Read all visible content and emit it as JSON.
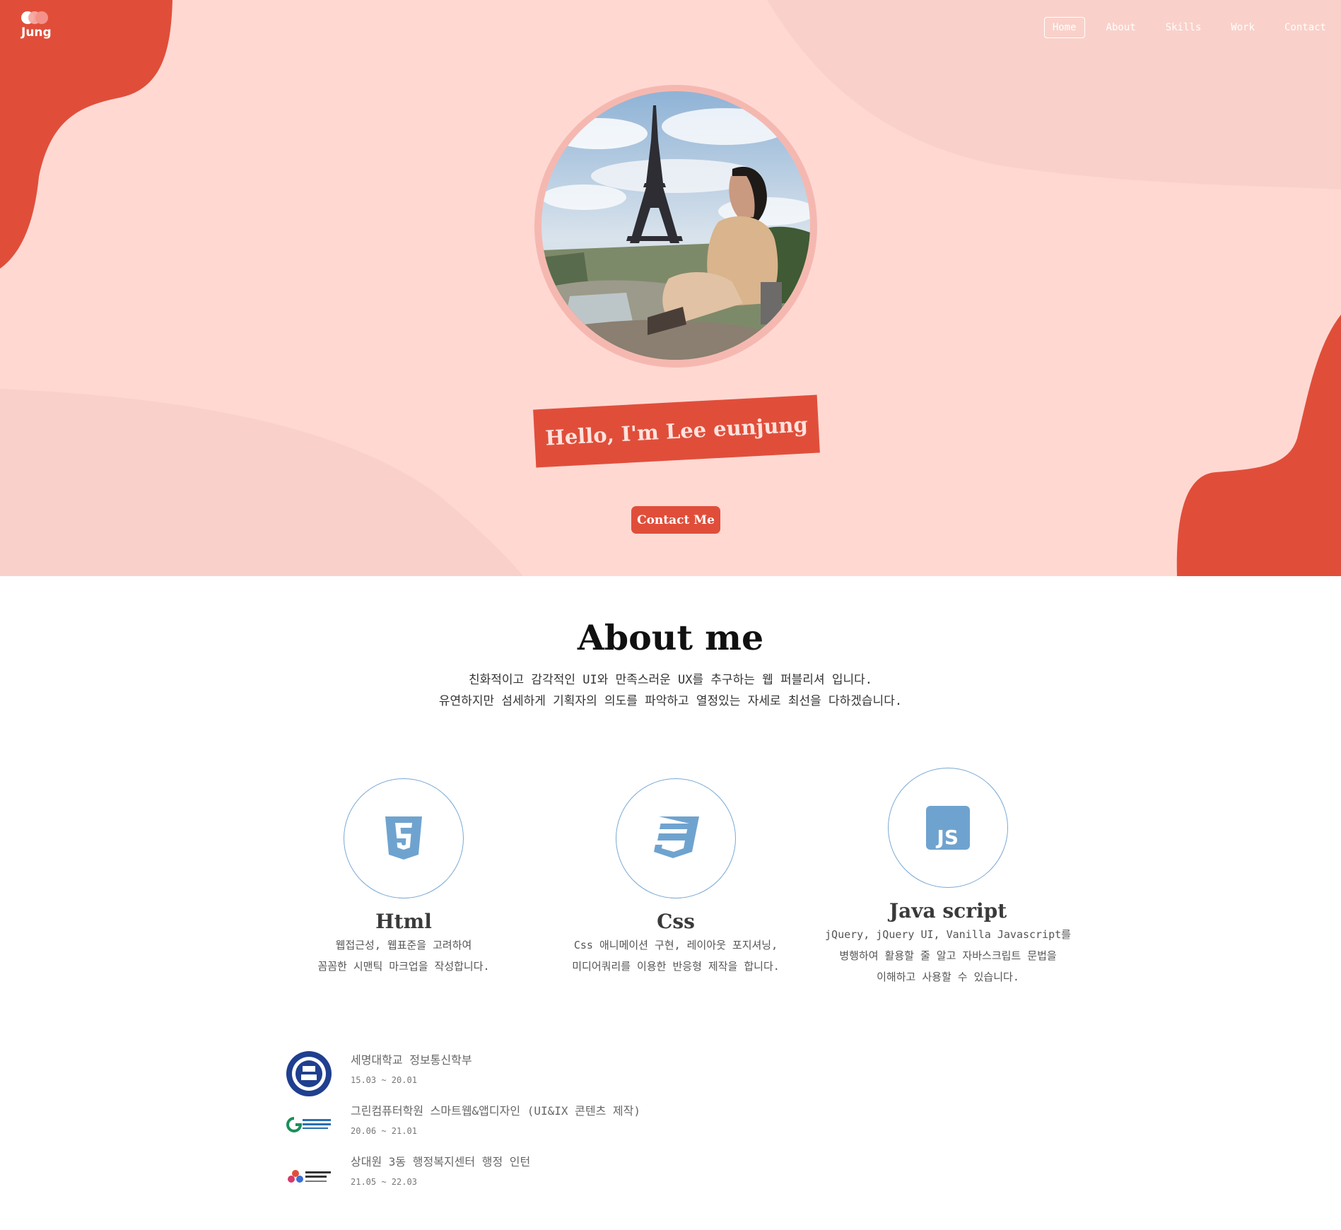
{
  "brand": {
    "logo_text": "Jung"
  },
  "nav": {
    "items": [
      "Home",
      "About",
      "Skills",
      "Work",
      "Contact"
    ],
    "active": "Home"
  },
  "hero": {
    "greeting": "Hello, I'm Lee eunjung",
    "contact_button": "Contact Me"
  },
  "about": {
    "title": "About me",
    "description_line1": "친화적이고 감각적인 UI와 만족스러운 UX를 추구하는 웹 퍼블리셔 입니다.",
    "description_line2": "유연하지만 섬세하게 기획자의 의도를 파악하고 열정있는 자세로 최선을 다하겠습니다."
  },
  "skills": [
    {
      "icon": "html5-icon",
      "name": "Html",
      "lines": [
        "웹접근성, 웹표준을 고려하여",
        "꼼꼼한 시맨틱 마크업을 작성합니다."
      ]
    },
    {
      "icon": "css3-icon",
      "name": "Css",
      "lines": [
        "Css 애니메이션 구현, 레이아웃 포지셔닝,",
        "미디어쿼리를 이용한 반응형 제작을 합니다."
      ]
    },
    {
      "icon": "javascript-icon",
      "name": "Java script",
      "lines": [
        "jQuery, jQuery UI, Vanilla Javascript를",
        "병행하여 활용할 줄 알고 자바스크립트 문법을",
        "이해하고 사용할 수 있습니다."
      ]
    }
  ],
  "education": [
    {
      "logo": "sejong-university-seal",
      "title": "세명대학교 정보통신학부",
      "date": "15.03 ~ 20.01"
    },
    {
      "logo": "green-computer-academy-logo",
      "title": "그린컴퓨터학원 스마트웹&앱디자인 (UI&IX 콘텐츠 제작)",
      "date": "20.06 ~ 21.01"
    },
    {
      "logo": "seongnam-city-logo",
      "title": "상대원 3동 행정복지센터 행정 인턴",
      "date": "21.05 ~ 22.03"
    }
  ],
  "colors": {
    "accent": "#e04e3a",
    "hero_bg": "#ffd8d2",
    "icon_blue": "#6fa3cf"
  }
}
